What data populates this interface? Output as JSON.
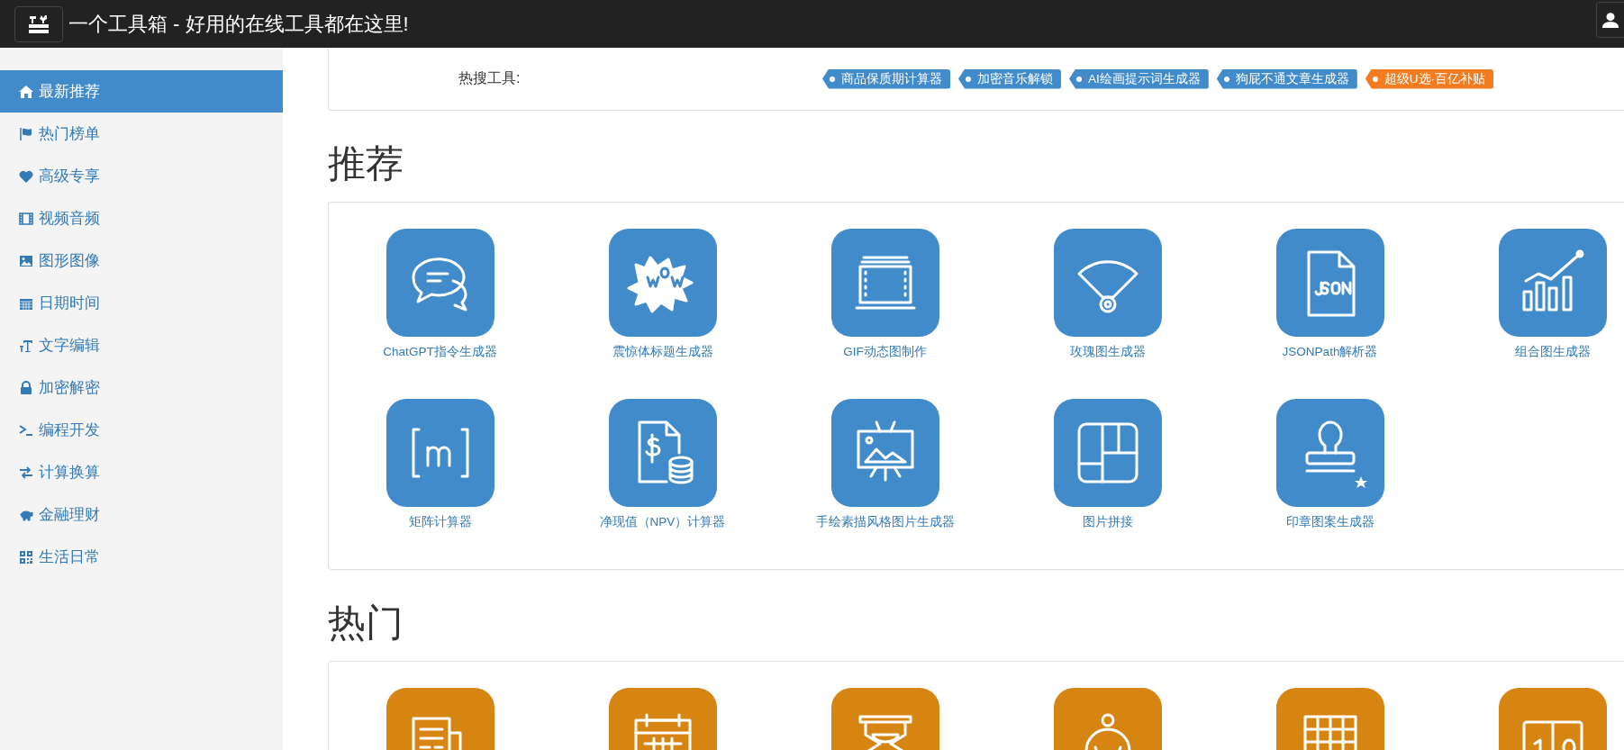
{
  "header": {
    "title": "一个工具箱 - 好用的在线工具都在这里!"
  },
  "sidebar": {
    "items": [
      {
        "label": "最新推荐",
        "kind": "home",
        "selected": true
      },
      {
        "label": "热门榜单",
        "kind": "flag",
        "selected": false
      },
      {
        "label": "高级专享",
        "kind": "heart",
        "selected": false
      },
      {
        "label": "视频音频",
        "kind": "film",
        "selected": false
      },
      {
        "label": "图形图像",
        "kind": "image",
        "selected": false
      },
      {
        "label": "日期时间",
        "kind": "calendar",
        "selected": false
      },
      {
        "label": "文字编辑",
        "kind": "text",
        "selected": false
      },
      {
        "label": "加密解密",
        "kind": "lock",
        "selected": false
      },
      {
        "label": "编程开发",
        "kind": "terminal",
        "selected": false
      },
      {
        "label": "计算换算",
        "kind": "exchange",
        "selected": false
      },
      {
        "label": "金融理财",
        "kind": "piggy",
        "selected": false
      },
      {
        "label": "生活日常",
        "kind": "qrcode",
        "selected": false
      }
    ]
  },
  "hot_search": {
    "label": "热搜工具:",
    "tags": [
      {
        "text": "商品保质期计算器",
        "color": "#428bca"
      },
      {
        "text": "加密音乐解锁",
        "color": "#428bca"
      },
      {
        "text": "AI绘画提示词生成器",
        "color": "#428bca"
      },
      {
        "text": "狗屁不通文章生成器",
        "color": "#428bca"
      },
      {
        "text": "超级U选·百亿补贴",
        "color": "#f47c20"
      }
    ]
  },
  "sections": [
    {
      "title": "推荐",
      "color": "#428bca",
      "tools": [
        {
          "label": "ChatGPT指令生成器",
          "kind": "chat"
        },
        {
          "label": "震惊体标题生成器",
          "kind": "wow"
        },
        {
          "label": "GIF动态图制作",
          "kind": "film"
        },
        {
          "label": "玫瑰图生成器",
          "kind": "rose"
        },
        {
          "label": "JSONPath解析器",
          "kind": "json"
        },
        {
          "label": "组合图生成器",
          "kind": "combo"
        },
        {
          "label": "矩阵计算器",
          "kind": "matrix"
        },
        {
          "label": "净现值（NPV）计算器",
          "kind": "money"
        },
        {
          "label": "手绘素描风格图片生成器",
          "kind": "easel"
        },
        {
          "label": "图片拼接",
          "kind": "collage"
        },
        {
          "label": "印章图案生成器",
          "kind": "stamp"
        }
      ]
    },
    {
      "title": "热门",
      "color": "#d68512",
      "tools": [
        {
          "kind": "news"
        },
        {
          "kind": "calendar"
        },
        {
          "kind": "hourglass"
        },
        {
          "kind": "person"
        },
        {
          "kind": "grid"
        },
        {
          "kind": "counter"
        }
      ]
    }
  ]
}
